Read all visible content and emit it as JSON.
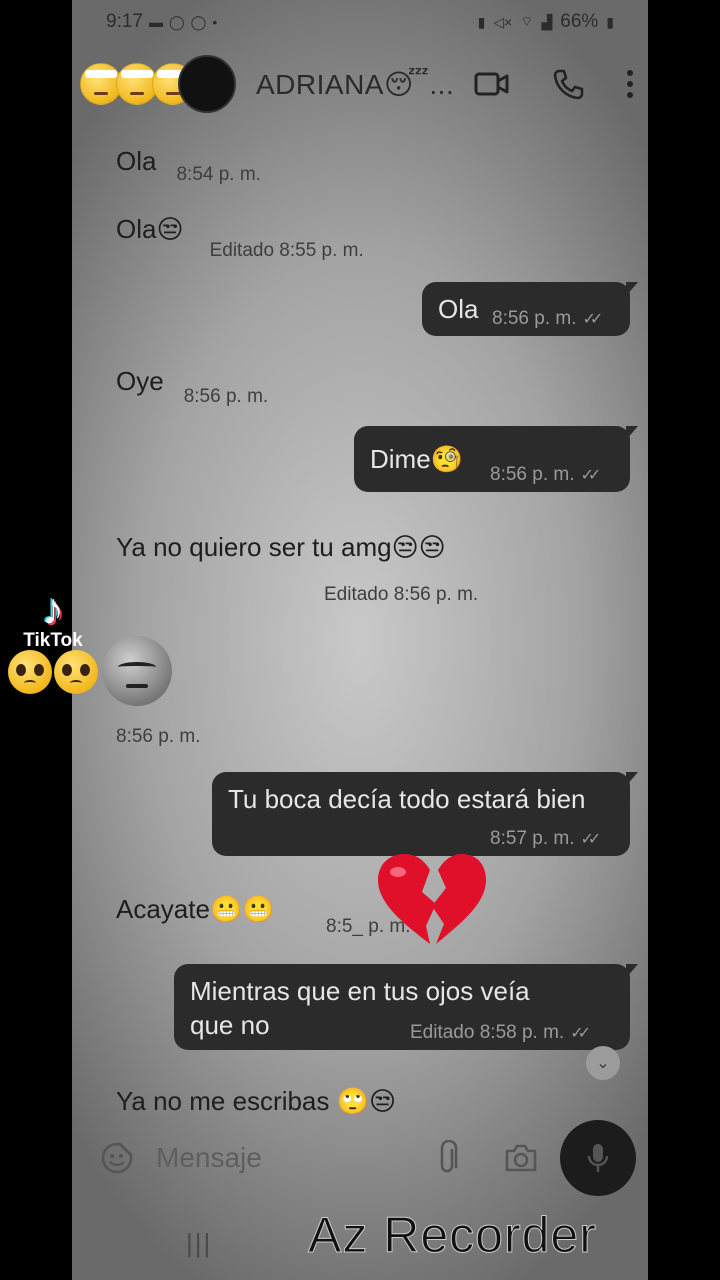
{
  "status_bar": {
    "time": "9:17",
    "battery": "66%"
  },
  "header": {
    "contact_name": "ADRIANA😴..."
  },
  "messages": [
    {
      "dir": "in",
      "text": "Ola",
      "time": "8:54 p. m."
    },
    {
      "dir": "in",
      "text": "Ola😒",
      "time": "Editado 8:55 p. m."
    },
    {
      "dir": "out",
      "text": "Ola",
      "time": "8:56 p. m."
    },
    {
      "dir": "in",
      "text": "Oye",
      "time": "8:56 p. m."
    },
    {
      "dir": "out",
      "text": "Dime🧐",
      "time": "8:56 p. m."
    },
    {
      "dir": "in",
      "text": "Ya no quiero ser tu amg😒😒",
      "time": "Editado 8:56 p. m."
    },
    {
      "dir": "in",
      "text": "😒",
      "time": "8:56 p. m."
    },
    {
      "dir": "out",
      "text": "Tu boca decía todo estará bien",
      "time": "8:57 p. m."
    },
    {
      "dir": "in",
      "text": "Acayate😬😬",
      "time": "8:5_ p. m."
    },
    {
      "dir": "out",
      "text": "Mientras que  en tus ojos veía que no",
      "time": "Editado 8:58 p. m."
    },
    {
      "dir": "in",
      "text": "Ya no me escribas 🙄😒",
      "time": ""
    }
  ],
  "input": {
    "placeholder": "Mensaje"
  },
  "overlay": {
    "tiktok_label": "TikTok",
    "watermark": "Az Recorder"
  }
}
